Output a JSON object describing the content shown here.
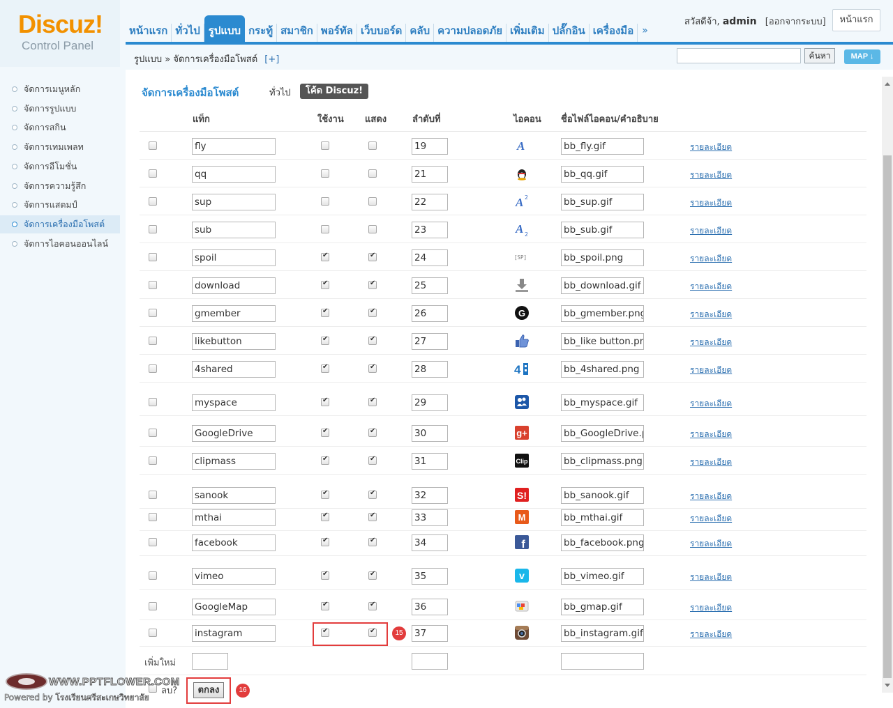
{
  "logo": {
    "title": "Discuz!",
    "subtitle": "Control Panel"
  },
  "topnav": {
    "items": [
      {
        "label": "หน้าแรก",
        "active": false
      },
      {
        "label": "ทั่วไป",
        "active": false
      },
      {
        "label": "รูปแบบ",
        "active": true
      },
      {
        "label": "กระทู้",
        "active": false
      },
      {
        "label": "สมาชิก",
        "active": false
      },
      {
        "label": "พอร์ทัล",
        "active": false
      },
      {
        "label": "เว็บบอร์ด",
        "active": false
      },
      {
        "label": "คลับ",
        "active": false
      },
      {
        "label": "ความปลอดภัย",
        "active": false
      },
      {
        "label": "เพิ่มเติม",
        "active": false
      },
      {
        "label": "ปลั๊กอิน",
        "active": false
      },
      {
        "label": "เครื่องมือ",
        "active": false
      }
    ],
    "more": "»"
  },
  "user": {
    "greeting": "สวัสดีจ้า,",
    "name": "admin",
    "logout": "[ออกจากระบบ]",
    "home_button": "หน้าแรก"
  },
  "breadcrumb": {
    "text": "รูปแบบ » จัดการเครื่องมือโพสต์",
    "plus": "[+]"
  },
  "search": {
    "value": "",
    "button": "ค้นหา"
  },
  "map_button": "MAP ↓",
  "sidebar": {
    "items": [
      {
        "label": "จัดการเมนูหลัก",
        "active": false
      },
      {
        "label": "จัดการรูปแบบ",
        "active": false
      },
      {
        "label": "จัดการสกิน",
        "active": false
      },
      {
        "label": "จัดการเทมเพลท",
        "active": false
      },
      {
        "label": "จัดการอีโมชั่น",
        "active": false
      },
      {
        "label": "จัดการความรู้สึก",
        "active": false
      },
      {
        "label": "จัดการแสตมป์",
        "active": false
      },
      {
        "label": "จัดการเครื่องมือโพสต์",
        "active": true
      },
      {
        "label": "จัดการไอคอนออนไลน์",
        "active": false
      }
    ]
  },
  "watermark": {
    "url": "WWW.PPTFLOWER.COM",
    "sub": "Powered by โรงเรียนศรีสะเกษวิทยาลัย"
  },
  "main": {
    "title": "จัดการเครื่องมือโพสต์",
    "tab_general": "ทั่วไป",
    "tab_code": "โค้ด Discuz!",
    "columns": {
      "tag": "แท็ก",
      "enabled": "ใช้งาน",
      "show": "แสดง",
      "order": "ลำดับที่",
      "icon": "ไอคอน",
      "filename": "ชื่อไฟล์ไอคอน/คำอธิบาย"
    },
    "detail_label": "รายละเอียด",
    "rows": [
      {
        "tag": "fly",
        "enabled": false,
        "show": false,
        "order": "19",
        "icon": "fly-icon",
        "file": "bb_fly.gif"
      },
      {
        "tag": "qq",
        "enabled": false,
        "show": false,
        "order": "21",
        "icon": "qq-penguin-icon",
        "file": "bb_qq.gif"
      },
      {
        "tag": "sup",
        "enabled": false,
        "show": false,
        "order": "22",
        "icon": "superscript-icon",
        "file": "bb_sup.gif"
      },
      {
        "tag": "sub",
        "enabled": false,
        "show": false,
        "order": "23",
        "icon": "subscript-icon",
        "file": "bb_sub.gif"
      },
      {
        "tag": "spoil",
        "enabled": true,
        "show": true,
        "order": "24",
        "icon": "spoiler-icon",
        "icon_text": "[SP]",
        "file": "bb_spoil.png"
      },
      {
        "tag": "download",
        "enabled": true,
        "show": true,
        "order": "25",
        "icon": "download-icon",
        "file": "bb_download.gif"
      },
      {
        "tag": "gmember",
        "enabled": true,
        "show": true,
        "order": "26",
        "icon": "gmember-icon",
        "icon_text": "G",
        "file": "bb_gmember.png"
      },
      {
        "tag": "likebutton",
        "enabled": true,
        "show": true,
        "order": "27",
        "icon": "thumbs-up-icon",
        "file": "bb_like button.png"
      },
      {
        "tag": "4shared",
        "enabled": true,
        "show": true,
        "order": "28",
        "icon": "4shared-icon",
        "icon_text": "4",
        "file": "bb_4shared.png"
      },
      {
        "tag": "myspace",
        "enabled": true,
        "show": true,
        "order": "29",
        "icon": "myspace-icon",
        "file": "bb_myspace.gif"
      },
      {
        "tag": "GoogleDrive",
        "enabled": true,
        "show": true,
        "order": "30",
        "icon": "google-plus-icon",
        "icon_text": "g+",
        "file": "bb_GoogleDrive.png"
      },
      {
        "tag": "clipmass",
        "enabled": true,
        "show": true,
        "order": "31",
        "icon": "clipmass-icon",
        "icon_text": "Clip",
        "file": "bb_clipmass.png"
      },
      {
        "tag": "sanook",
        "enabled": true,
        "show": true,
        "order": "32",
        "icon": "sanook-icon",
        "icon_text": "S!",
        "file": "bb_sanook.gif"
      },
      {
        "tag": "mthai",
        "enabled": true,
        "show": true,
        "order": "33",
        "icon": "mthai-icon",
        "icon_text": "M",
        "file": "bb_mthai.gif"
      },
      {
        "tag": "facebook",
        "enabled": true,
        "show": true,
        "order": "34",
        "icon": "facebook-icon",
        "icon_text": "f",
        "file": "bb_facebook.png"
      },
      {
        "tag": "vimeo",
        "enabled": true,
        "show": true,
        "order": "35",
        "icon": "vimeo-icon",
        "icon_text": "v",
        "file": "bb_vimeo.gif"
      },
      {
        "tag": "GoogleMap",
        "enabled": true,
        "show": true,
        "order": "36",
        "icon": "google-map-icon",
        "file": "bb_gmap.gif"
      },
      {
        "tag": "instagram",
        "enabled": true,
        "show": true,
        "order": "37",
        "icon": "instagram-icon",
        "file": "bb_instagram.gif"
      }
    ],
    "add_new_label": "เพิ่มใหม่",
    "delete_label": "ลบ?",
    "submit_button": "ตกลง"
  },
  "annotations": {
    "step1": "15",
    "step2": "16"
  },
  "colors": {
    "accent": "#2b8ad0",
    "highlight": "#e23c3c",
    "logo": "#f29100"
  }
}
